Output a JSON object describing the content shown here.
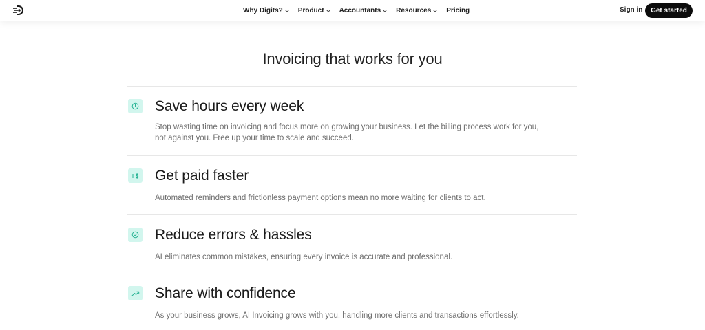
{
  "nav": {
    "items": [
      {
        "label": "Why Digits?"
      },
      {
        "label": "Product"
      },
      {
        "label": "Accountants"
      },
      {
        "label": "Resources"
      },
      {
        "label": "Pricing"
      }
    ],
    "signin": "Sign in",
    "cta": "Get started"
  },
  "section": {
    "title": "Invoicing that works for you"
  },
  "features": [
    {
      "icon": "clock-icon",
      "title": "Save hours every week",
      "description": "Stop wasting time on invoicing and focus more on growing your business. Let the billing process work for you, not against you. Free up your time to scale and succeed."
    },
    {
      "icon": "dollar-list-icon",
      "title": "Get paid faster",
      "description": "Automated reminders and frictionless payment options mean no more waiting for clients to act."
    },
    {
      "icon": "check-circle-icon",
      "title": "Reduce errors & hassles",
      "description": "AI eliminates common mistakes, ensuring every invoice is accurate and professional."
    },
    {
      "icon": "trend-up-icon",
      "title": "Share with confidence",
      "description": "As your business grows, AI Invoicing grows with you, handling more clients and transactions effortlessly."
    }
  ],
  "colors": {
    "accent_bg": "#d2f6ee",
    "accent_icon": "#27b394",
    "cta_bg": "#0c0c0c"
  }
}
